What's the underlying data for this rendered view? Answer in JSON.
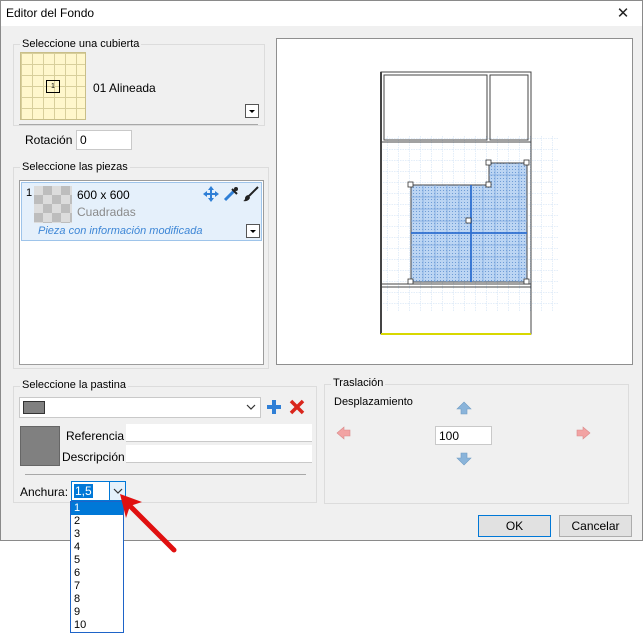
{
  "window": {
    "title": "Editor del Fondo",
    "close_glyph": "✕"
  },
  "cubierta": {
    "group_label": "Seleccione una cubierta",
    "selected_name": "01 Alineada",
    "thumb_mark": "1",
    "rotation_label": "Rotación",
    "rotation_value": "0"
  },
  "piezas": {
    "group_label": "Seleccione las piezas",
    "items": [
      {
        "index": "1",
        "size": "600 x 600",
        "name": "Cuadradas",
        "note": "Pieza con información modificada"
      }
    ]
  },
  "pastina": {
    "group_label": "Seleccione la pastina",
    "color_value": "",
    "referencia_label": "Referencia",
    "referencia_value": "",
    "descripcion_label": "Descripción",
    "descripcion_value": "",
    "anchura_label": "Anchura:",
    "anchura_value": "1,5",
    "anchura_options": [
      "1",
      "2",
      "3",
      "4",
      "5",
      "6",
      "7",
      "8",
      "9",
      "10"
    ],
    "anchura_highlighted": "1"
  },
  "traslacion": {
    "group_label": "Traslación",
    "sub_label": "Desplazamiento",
    "value": "100"
  },
  "buttons": {
    "ok": "OK",
    "cancel": "Cancelar"
  },
  "colors": {
    "accent": "#0078d7",
    "tile_blue": "#5b9bd5",
    "delete_red": "#d9261c",
    "add_blue": "#2f7fd6",
    "annotation_red": "#e01010"
  },
  "icons": [
    "close-icon",
    "dropdown-arrow-icon",
    "move-icon",
    "pick-tool-icon",
    "brush-icon",
    "add-icon",
    "delete-icon",
    "arrow-up-icon",
    "arrow-down-icon",
    "arrow-left-icon",
    "arrow-right-icon",
    "pointer-arrow-icon"
  ]
}
